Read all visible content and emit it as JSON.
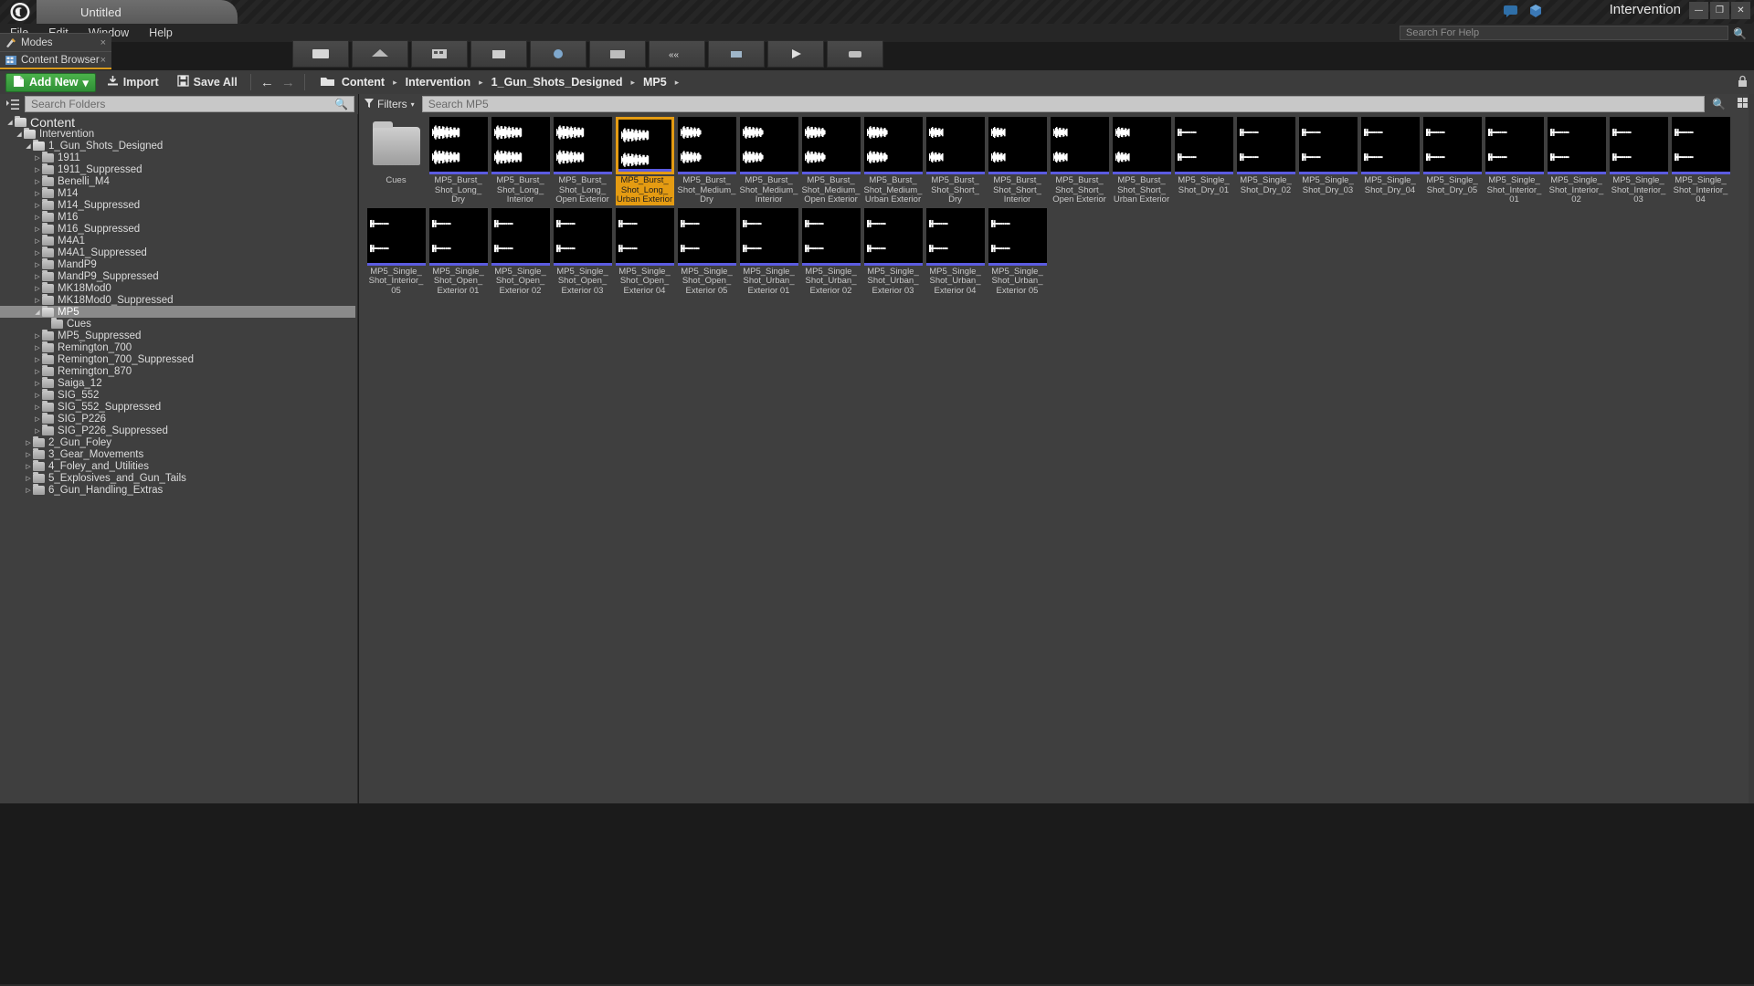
{
  "window": {
    "app_icon": "unreal-logo-icon",
    "document_tab": "Untitled",
    "project_title": "Intervention",
    "title_icons": [
      "feedback-icon",
      "cube-icon"
    ],
    "controls": {
      "minimize": "—",
      "maximize": "❐",
      "close": "✕"
    }
  },
  "menu": {
    "items": [
      "File",
      "Edit",
      "Window",
      "Help"
    ],
    "help_search_placeholder": "Search For Help",
    "help_search_icon": "search-icon"
  },
  "panel_tabs": [
    {
      "label": "Modes",
      "icon": "modes-icon",
      "close": "×",
      "active": false
    },
    {
      "label": "Content Browser",
      "icon": "content-browser-icon",
      "close": "×",
      "active": true
    }
  ],
  "toolbar": {
    "add_new_label": "Add New",
    "add_new_icon": "new-asset-icon",
    "add_new_caret": "▾",
    "import_label": "Import",
    "import_icon": "import-icon",
    "save_all_label": "Save All",
    "save_all_icon": "floppy-icon",
    "back_icon": "←",
    "forward_icon": "→",
    "path_folder_icon": "folder-open-icon",
    "breadcrumb": [
      "Content",
      "Intervention",
      "1_Gun_Shots_Designed",
      "MP5"
    ],
    "breadcrumb_separator": "▸",
    "trailing_separator": "▸"
  },
  "sources": {
    "search_placeholder": "Search Folders",
    "search_icon": "search-icon",
    "tree_toggle_icon": "tree-expand-icon",
    "tree": [
      {
        "label": "Content",
        "depth": 0,
        "state": "expanded",
        "root": true
      },
      {
        "label": "Intervention",
        "depth": 1,
        "state": "expanded"
      },
      {
        "label": "1_Gun_Shots_Designed",
        "depth": 2,
        "state": "expanded"
      },
      {
        "label": "1911",
        "depth": 3,
        "state": "collapsed"
      },
      {
        "label": "1911_Suppressed",
        "depth": 3,
        "state": "collapsed"
      },
      {
        "label": "Benelli_M4",
        "depth": 3,
        "state": "collapsed"
      },
      {
        "label": "M14",
        "depth": 3,
        "state": "collapsed"
      },
      {
        "label": "M14_Suppressed",
        "depth": 3,
        "state": "collapsed"
      },
      {
        "label": "M16",
        "depth": 3,
        "state": "collapsed"
      },
      {
        "label": "M16_Suppressed",
        "depth": 3,
        "state": "collapsed"
      },
      {
        "label": "M4A1",
        "depth": 3,
        "state": "collapsed"
      },
      {
        "label": "M4A1_Suppressed",
        "depth": 3,
        "state": "collapsed"
      },
      {
        "label": "MandP9",
        "depth": 3,
        "state": "collapsed"
      },
      {
        "label": "MandP9_Suppressed",
        "depth": 3,
        "state": "collapsed"
      },
      {
        "label": "MK18Mod0",
        "depth": 3,
        "state": "collapsed"
      },
      {
        "label": "MK18Mod0_Suppressed",
        "depth": 3,
        "state": "collapsed"
      },
      {
        "label": "MP5",
        "depth": 3,
        "state": "expanded",
        "selected": true
      },
      {
        "label": "Cues",
        "depth": 4,
        "state": "leaf"
      },
      {
        "label": "MP5_Suppressed",
        "depth": 3,
        "state": "collapsed"
      },
      {
        "label": "Remington_700",
        "depth": 3,
        "state": "collapsed"
      },
      {
        "label": "Remington_700_Suppressed",
        "depth": 3,
        "state": "collapsed"
      },
      {
        "label": "Remington_870",
        "depth": 3,
        "state": "collapsed"
      },
      {
        "label": "Saiga_12",
        "depth": 3,
        "state": "collapsed"
      },
      {
        "label": "SIG_552",
        "depth": 3,
        "state": "collapsed"
      },
      {
        "label": "SIG_552_Suppressed",
        "depth": 3,
        "state": "collapsed"
      },
      {
        "label": "SIG_P226",
        "depth": 3,
        "state": "collapsed"
      },
      {
        "label": "SIG_P226_Suppressed",
        "depth": 3,
        "state": "collapsed"
      },
      {
        "label": "2_Gun_Foley",
        "depth": 2,
        "state": "collapsed"
      },
      {
        "label": "3_Gear_Movements",
        "depth": 2,
        "state": "collapsed"
      },
      {
        "label": "4_Foley_and_Utilities",
        "depth": 2,
        "state": "collapsed"
      },
      {
        "label": "5_Explosives_and_Gun_Tails",
        "depth": 2,
        "state": "collapsed"
      },
      {
        "label": "6_Gun_Handling_Extras",
        "depth": 2,
        "state": "collapsed"
      }
    ]
  },
  "asset_view": {
    "filters_label": "Filters",
    "filters_icon": "funnel-icon",
    "filters_caret": "▾",
    "search_placeholder": "Search MP5",
    "search_icon": "search-icon",
    "view_options_icon": "view-options-icon",
    "accent_selection_color": "#e49b12",
    "audio_bar_color": "#5b5be0",
    "items": [
      {
        "name": "Cues",
        "type": "folder"
      },
      {
        "name": "MP5_Burst_Shot_Long_Dry",
        "type": "sound",
        "wave": "burst"
      },
      {
        "name": "MP5_Burst_Shot_Long_Interior",
        "type": "sound",
        "wave": "burst"
      },
      {
        "name": "MP5_Burst_Shot_Long_Open Exterior",
        "type": "sound",
        "wave": "burst"
      },
      {
        "name": "MP5_Burst_Shot_Long_Urban Exterior",
        "type": "sound",
        "wave": "burst",
        "selected": true
      },
      {
        "name": "MP5_Burst_Shot_Medium_Dry",
        "type": "sound",
        "wave": "medium"
      },
      {
        "name": "MP5_Burst_Shot_Medium_Interior",
        "type": "sound",
        "wave": "medium"
      },
      {
        "name": "MP5_Burst_Shot_Medium_Open Exterior",
        "type": "sound",
        "wave": "medium"
      },
      {
        "name": "MP5_Burst_Shot_Medium_Urban Exterior",
        "type": "sound",
        "wave": "medium"
      },
      {
        "name": "MP5_Burst_Shot_Short_Dry",
        "type": "sound",
        "wave": "short"
      },
      {
        "name": "MP5_Burst_Shot_Short_Interior",
        "type": "sound",
        "wave": "short"
      },
      {
        "name": "MP5_Burst_Shot_Short_Open Exterior",
        "type": "sound",
        "wave": "short"
      },
      {
        "name": "MP5_Burst_Shot_Short_Urban Exterior",
        "type": "sound",
        "wave": "short"
      },
      {
        "name": "MP5_Single_Shot_Dry_01",
        "type": "sound",
        "wave": "single"
      },
      {
        "name": "MP5_Single_Shot_Dry_02",
        "type": "sound",
        "wave": "single"
      },
      {
        "name": "MP5_Single_Shot_Dry_03",
        "type": "sound",
        "wave": "single"
      },
      {
        "name": "MP5_Single_Shot_Dry_04",
        "type": "sound",
        "wave": "single"
      },
      {
        "name": "MP5_Single_Shot_Dry_05",
        "type": "sound",
        "wave": "single"
      },
      {
        "name": "MP5_Single_Shot_Interior_01",
        "type": "sound",
        "wave": "single"
      },
      {
        "name": "MP5_Single_Shot_Interior_02",
        "type": "sound",
        "wave": "single"
      },
      {
        "name": "MP5_Single_Shot_Interior_03",
        "type": "sound",
        "wave": "single"
      },
      {
        "name": "MP5_Single_Shot_Interior_04",
        "type": "sound",
        "wave": "single"
      },
      {
        "name": "MP5_Single_Shot_Interior_05",
        "type": "sound",
        "wave": "single"
      },
      {
        "name": "MP5_Single_Shot_Open_Exterior 01",
        "type": "sound",
        "wave": "single"
      },
      {
        "name": "MP5_Single_Shot_Open_Exterior 02",
        "type": "sound",
        "wave": "single"
      },
      {
        "name": "MP5_Single_Shot_Open_Exterior 03",
        "type": "sound",
        "wave": "single"
      },
      {
        "name": "MP5_Single_Shot_Open_Exterior 04",
        "type": "sound",
        "wave": "single"
      },
      {
        "name": "MP5_Single_Shot_Open_Exterior 05",
        "type": "sound",
        "wave": "single"
      },
      {
        "name": "MP5_Single_Shot_Urban_Exterior 01",
        "type": "sound",
        "wave": "single"
      },
      {
        "name": "MP5_Single_Shot_Urban_Exterior 02",
        "type": "sound",
        "wave": "single"
      },
      {
        "name": "MP5_Single_Shot_Urban_Exterior 03",
        "type": "sound",
        "wave": "single"
      },
      {
        "name": "MP5_Single_Shot_Urban_Exterior 04",
        "type": "sound",
        "wave": "single"
      },
      {
        "name": "MP5_Single_Shot_Urban_Exterior 05",
        "type": "sound",
        "wave": "single"
      }
    ]
  }
}
